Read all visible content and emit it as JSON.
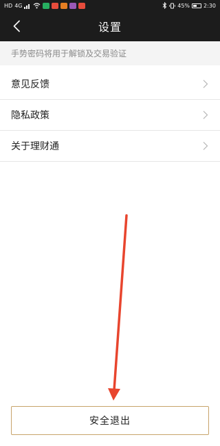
{
  "status_bar": {
    "network": "HD",
    "signal": "4G",
    "battery_percent": "45%",
    "battery_level": 0.45,
    "time": "2:30",
    "app_icon_colors": [
      "#27ae60",
      "#e74c3c",
      "#e67e22",
      "#9b59b6",
      "#e74c3c"
    ]
  },
  "header": {
    "title": "设置",
    "back_icon": "chevron-left-icon"
  },
  "hint": {
    "text": "手势密码将用于解锁及交易验证"
  },
  "menu": {
    "items": [
      {
        "label": "意见反馈",
        "icon": "chevron-right-icon"
      },
      {
        "label": "隐私政策",
        "icon": "chevron-right-icon"
      },
      {
        "label": "关于理财通",
        "icon": "chevron-right-icon"
      }
    ]
  },
  "footer": {
    "logout_label": "安全退出"
  },
  "colors": {
    "nav_background": "#1c1c1c",
    "logout_border": "#c7a36a",
    "annotation_arrow": "#e8452e"
  }
}
